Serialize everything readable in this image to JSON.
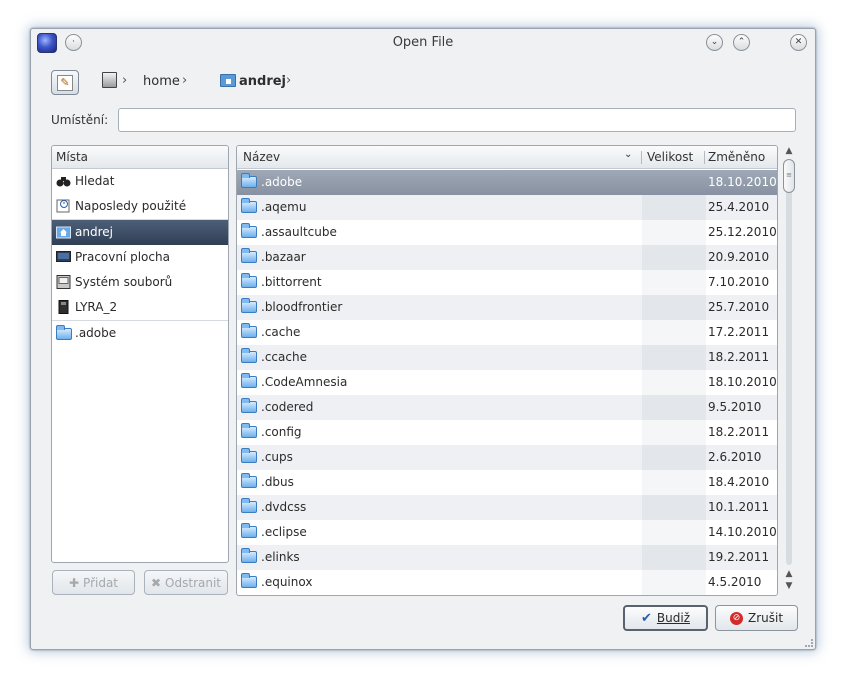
{
  "window": {
    "title": "Open File"
  },
  "titlebar": {
    "minimize_icon": "chevron-down-icon",
    "maximize_icon": "chevron-up-icon",
    "close_icon": "close-icon"
  },
  "breadcrumb": {
    "items": [
      "home",
      "andrej"
    ]
  },
  "location": {
    "label": "Umístění:",
    "value": "",
    "placeholder": ""
  },
  "places": {
    "header": "Místa",
    "items": [
      {
        "label": "Hledat",
        "icon": "binoculars-icon"
      },
      {
        "label": "Naposledy použité",
        "icon": "recent-icon"
      },
      {
        "label": "andrej",
        "icon": "home-folder-icon"
      },
      {
        "label": "Pracovní plocha",
        "icon": "desktop-icon"
      },
      {
        "label": "Systém souborů",
        "icon": "drive-icon"
      },
      {
        "label": "LYRA_2",
        "icon": "usb-drive-icon"
      },
      {
        "label": ".adobe",
        "icon": "folder-icon"
      }
    ],
    "add_label": "Přidat",
    "remove_label": "Odstranit"
  },
  "files": {
    "columns": {
      "name": "Název",
      "size": "Velikost",
      "modified": "Změněno"
    },
    "rows": [
      {
        "name": ".adobe",
        "date": "18.10.2010"
      },
      {
        "name": ".aqemu",
        "date": "25.4.2010"
      },
      {
        "name": ".assaultcube",
        "date": "25.12.2010"
      },
      {
        "name": ".bazaar",
        "date": "20.9.2010"
      },
      {
        "name": ".bittorrent",
        "date": "7.10.2010"
      },
      {
        "name": ".bloodfrontier",
        "date": "25.7.2010"
      },
      {
        "name": ".cache",
        "date": "17.2.2011"
      },
      {
        "name": ".ccache",
        "date": "18.2.2011"
      },
      {
        "name": ".CodeAmnesia",
        "date": "18.10.2010"
      },
      {
        "name": ".codered",
        "date": "9.5.2010"
      },
      {
        "name": ".config",
        "date": "18.2.2011"
      },
      {
        "name": ".cups",
        "date": "2.6.2010"
      },
      {
        "name": ".dbus",
        "date": "18.4.2010"
      },
      {
        "name": ".dvdcss",
        "date": "10.1.2011"
      },
      {
        "name": ".eclipse",
        "date": "14.10.2010"
      },
      {
        "name": ".elinks",
        "date": "19.2.2011"
      },
      {
        "name": ".equinox",
        "date": "4.5.2010"
      }
    ]
  },
  "buttons": {
    "ok_label": "Budiž",
    "cancel_label": "Zrušit"
  },
  "colors": {
    "selection": "#4d5f78",
    "row_selected": "#9ea8b6",
    "folder": "#6eb0ec",
    "cancel_red": "#d52a2a"
  }
}
